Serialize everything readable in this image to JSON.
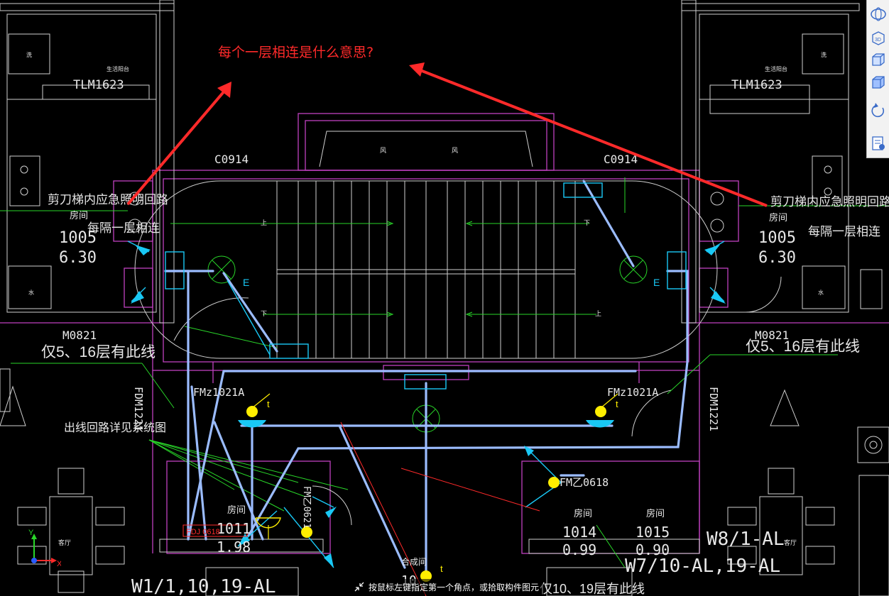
{
  "annotation": {
    "question": "每个一层相连是什么意思?",
    "color": "#ff2a2a"
  },
  "labels": {
    "tlm_left": "TLM1623",
    "tlm_right": "TLM1623",
    "c0914_left": "C0914",
    "c0914_right": "C0914",
    "emergency_left": "剪刀梯内应急照明回路",
    "every_floor_left": "每隔一层相连",
    "emergency_right": "剪刀梯内应急照明回路",
    "every_floor_right": "每隔一层相连",
    "room_left": "房间",
    "num_left": "1005",
    "height_left": "6.30",
    "room_right": "房间",
    "num_right": "1005",
    "height_right": "6.30",
    "m0821_left": "M0821",
    "m0821_right": "M0821",
    "only_left": "仅5、16层有此线",
    "only_right": "仅5、16层有此线",
    "fmz_left": "FMz1021A",
    "fmz_right": "FMz1021A",
    "fdm_left": "FDM1221",
    "fdm_right": "FDM1221",
    "outgoing": "出线回路详见系统图",
    "fm_bottom": "FM乙0618",
    "fm_mid": "FM乙0621",
    "room_1011": "房间",
    "num_1011": "1011",
    "height_1011": "1.98",
    "room_1014": "房间",
    "num_1014": "1014",
    "height_1014": "0.99",
    "room_1015": "房间",
    "num_1015": "1015",
    "height_1015": "0.90",
    "w8": "W8/1-AL",
    "w7": "W7/10-AL,19-AL",
    "w1": "W1/1,10,19-AL",
    "bottom_room": "合成间",
    "bottom_num": "10",
    "bottom_only": "仅10、19层有此线",
    "living": "客厅",
    "living2": "客厅",
    "balcony_left": "生活阳台",
    "balcony_right": "生活阳台",
    "fan_left": "风",
    "fan_right": "风",
    "wash_left": "洗",
    "wash_right": "洗",
    "water_left": "水",
    "water_right": "水",
    "e_left": "E",
    "e_right": "E",
    "up": "上",
    "down": "下",
    "t_label": "t",
    "fdj": "FDJ 0618"
  },
  "toolbar": [
    {
      "name": "orbit-icon"
    },
    {
      "name": "3d-view-icon",
      "text": "3D"
    },
    {
      "name": "top-view-icon"
    },
    {
      "name": "iso-view-icon"
    },
    {
      "name": "rotate-icon"
    },
    {
      "name": "properties-icon"
    }
  ],
  "axis": {
    "x": "X",
    "y": "Y"
  },
  "status": {
    "prompt": "按鼠标左键指定第一个角点，或拾取构件图元"
  }
}
